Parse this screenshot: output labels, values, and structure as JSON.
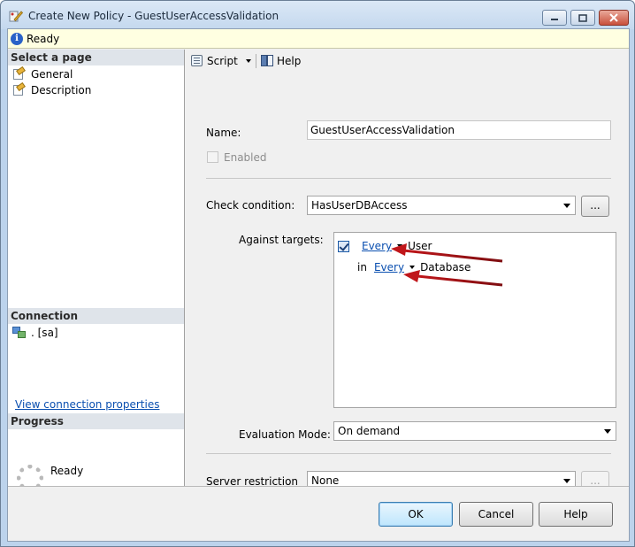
{
  "window": {
    "title": "Create New Policy - GuestUserAccessValidation",
    "minimize_icon": "minimize-icon",
    "maximize_icon": "maximize-icon",
    "close_icon": "close-icon"
  },
  "status": {
    "icon": "info-icon",
    "text": "Ready"
  },
  "left_pane": {
    "select_page_header": "Select a page",
    "pages": [
      {
        "label": "General",
        "icon": "page-properties-icon"
      },
      {
        "label": "Description",
        "icon": "page-properties-icon"
      }
    ],
    "connection_header": "Connection",
    "connection_item": ". [sa]",
    "view_connection_link": "View connection properties",
    "progress_header": "Progress",
    "progress_status": "Ready"
  },
  "toolbar": {
    "script_label": "Script",
    "help_label": "Help"
  },
  "form": {
    "name_label": "Name:",
    "name_value": "GuestUserAccessValidation",
    "enabled_label": "Enabled",
    "enabled_checked": false,
    "check_condition_label": "Check condition:",
    "check_condition_value": "HasUserDBAccess",
    "ellipsis_label": "...",
    "against_targets_label": "Against targets:",
    "targets": {
      "row1": {
        "checked": true,
        "link": "Every",
        "object": "User"
      },
      "row2": {
        "prefix": "in",
        "link": "Every",
        "object": "Database"
      }
    },
    "evaluation_mode_label": "Evaluation Mode:",
    "evaluation_mode_value": "On demand",
    "server_restriction_label": "Server restriction",
    "server_restriction_value": "None"
  },
  "buttons": {
    "ok": "OK",
    "cancel": "Cancel",
    "help": "Help"
  },
  "colors": {
    "link": "#0a4fb0",
    "annotation_arrow": "#c0161a",
    "status_bar": "#ffffe1"
  }
}
